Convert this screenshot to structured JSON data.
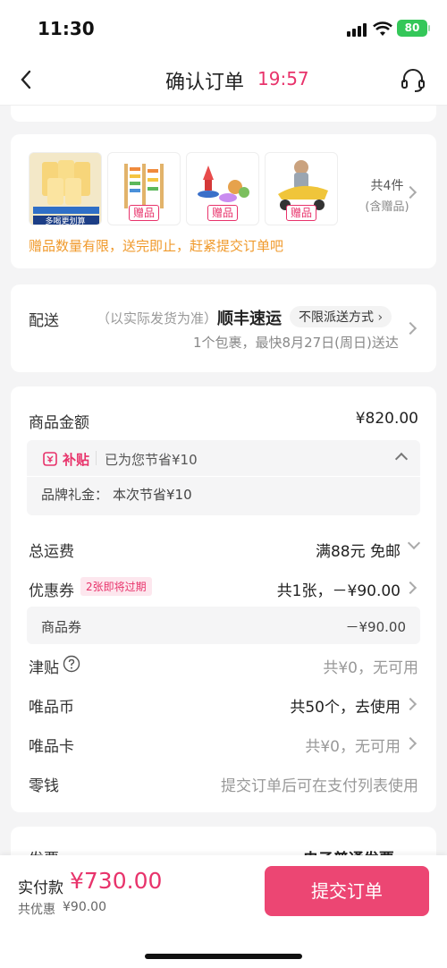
{
  "status": {
    "time": "11:30",
    "battery": "80"
  },
  "nav": {
    "title": "确认订单",
    "timer": "19:57"
  },
  "products": {
    "gift_tag": "赠品",
    "count": "共4件",
    "count_note": "(含赠品)",
    "notice": "赠品数量有限，送完即止，赶紧提交订单吧",
    "item1_caption": "多喝更划算"
  },
  "delivery": {
    "label": "配送",
    "hint": "（以实际发货为准）",
    "carrier": "顺丰速运",
    "method": "不限派送方式",
    "eta": "1个包裹，最快8月27日(周日)送达"
  },
  "amounts": {
    "goods_label": "商品金额",
    "goods_value": "¥820.00",
    "subsidy_tag": "补贴",
    "subsidy_text": "已为您节省¥10",
    "brand_gift_label": "品牌礼金：",
    "brand_gift_value": "本次节省¥10",
    "shipping_label": "总运费",
    "shipping_value": "满88元 免邮",
    "coupon_label": "优惠券",
    "coupon_badge": "2张即将过期",
    "coupon_value": "共1张，－¥90.00",
    "goods_coupon_label": "商品券",
    "goods_coupon_value": "－¥90.00",
    "jintie_label": "津贴",
    "jintie_value": "共¥0，无可用",
    "coin_label": "唯品币",
    "coin_value": "共50个，去使用",
    "card_label": "唯品卡",
    "card_value": "共¥0，无可用",
    "change_label": "零钱",
    "change_value": "提交订单后可在支付列表使用"
  },
  "invoice": {
    "label": "发票",
    "value": "电子普通发票-"
  },
  "footer": {
    "paid_label": "实付款",
    "paid_value": "¥730.00",
    "discount_label": "共优惠",
    "discount_value": "¥90.00",
    "submit": "提交订单"
  },
  "colors": {
    "accent": "#e8336b",
    "button": "#ec4673",
    "notice": "#f09a2c"
  }
}
